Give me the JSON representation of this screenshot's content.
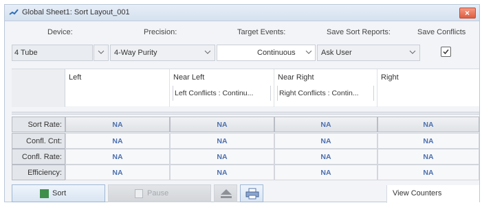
{
  "window": {
    "title": "Global Sheet1: Sort Layout_001"
  },
  "labels": {
    "device": "Device:",
    "precision": "Precision:",
    "target_events": "Target Events:",
    "save_sort_reports": "Save Sort Reports:",
    "save_conflicts": "Save Conflicts"
  },
  "controls": {
    "device": "4 Tube",
    "precision": "4-Way Purity",
    "target_events": "Continuous",
    "save_sort_reports": "Ask User",
    "save_conflicts_checked": true
  },
  "columns": [
    {
      "name": "Left",
      "sub": ""
    },
    {
      "name": "Near Left",
      "sub": "Left Conflicts : Continu..."
    },
    {
      "name": "Near Right",
      "sub": "Right Conflicts : Contin..."
    },
    {
      "name": "Right",
      "sub": ""
    }
  ],
  "rows": [
    {
      "label": "Sort Rate:",
      "values": [
        "NA",
        "NA",
        "NA",
        "NA"
      ]
    },
    {
      "label": "Confl. Cnt:",
      "values": [
        "NA",
        "NA",
        "NA",
        "NA"
      ]
    },
    {
      "label": "Confl. Rate:",
      "values": [
        "NA",
        "NA",
        "NA",
        "NA"
      ]
    },
    {
      "label": "Efficiency:",
      "values": [
        "NA",
        "NA",
        "NA",
        "NA"
      ]
    }
  ],
  "toolbar": {
    "sort": "Sort",
    "pause": "Pause",
    "view_counters": "View Counters"
  },
  "colors": {
    "accent": "#4b6fb0",
    "close": "#e05d3f",
    "sort_icon": "#3f8f4a"
  }
}
